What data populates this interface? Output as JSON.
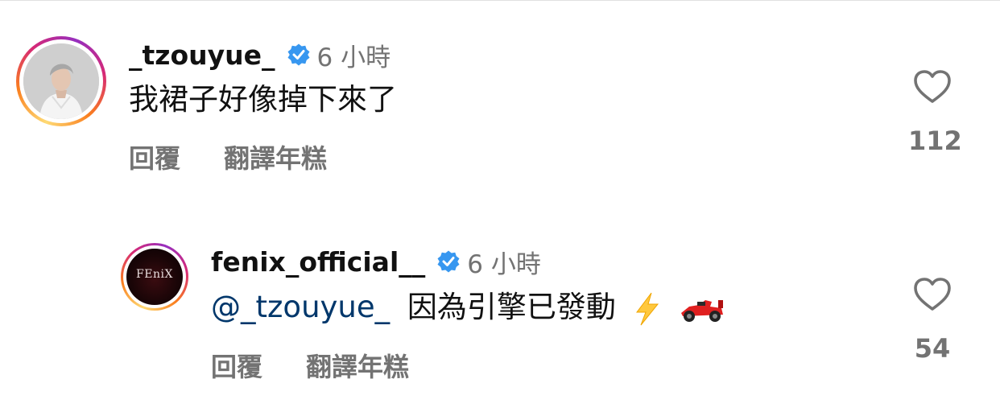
{
  "comments": [
    {
      "username": "_tzouyue_",
      "timestamp": "6 小時",
      "text": "我裙子好像掉下來了",
      "reply_label": "回覆",
      "translate_label": "翻譯年糕",
      "likes": "112",
      "avatar": "profile-photo-person"
    },
    {
      "username": "fenix_official__",
      "timestamp": "6 小時",
      "mention": "@_tzouyue_",
      "text": "因為引擎已發動",
      "emojis": [
        "high-voltage-emoji",
        "racing-car-emoji"
      ],
      "reply_label": "回覆",
      "translate_label": "翻譯年糕",
      "likes": "54",
      "avatar_text": "FEniX"
    }
  ],
  "colors": {
    "username": "#111111",
    "meta": "#737373",
    "mention": "#00376b",
    "verified": "#3797f0",
    "ring_start": "#feda75",
    "ring_mid": "#d62976",
    "ring_end": "#962fbf"
  }
}
